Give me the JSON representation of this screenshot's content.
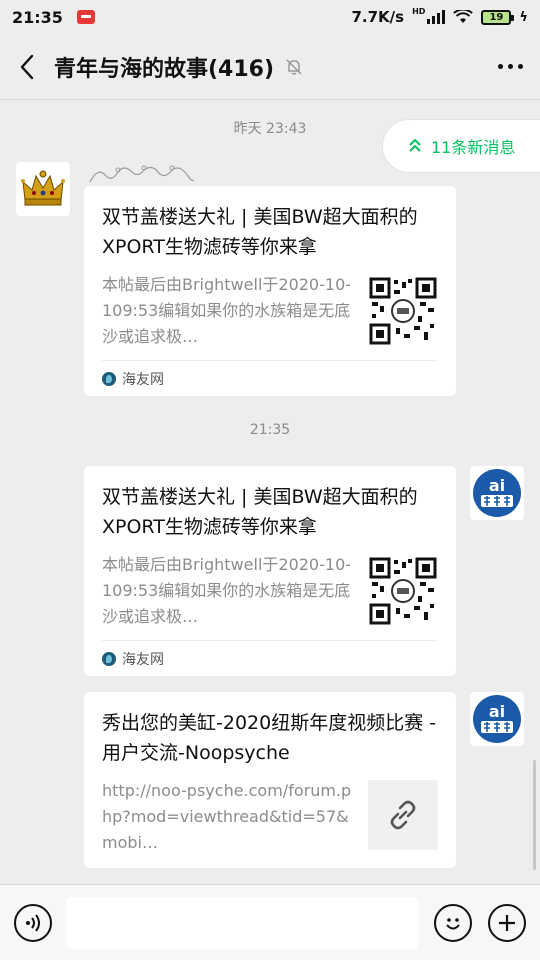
{
  "status_bar": {
    "time": "21:35",
    "net_speed": "7.7K/s",
    "hd_label": "HD",
    "battery": "19"
  },
  "header": {
    "title": "青年与海的故事(416)"
  },
  "new_messages": {
    "label": "11条新消息"
  },
  "timestamps": {
    "yesterday": "昨天 23:43",
    "today": "21:35"
  },
  "messages": [
    {
      "title": "双节盖楼送大礼 | 美国BW超大面积的XPORT生物滤砖等你来拿",
      "desc": "本帖最后由Brightwell于2020-10-109:53编辑如果你的水族箱是无底沙或追求极…",
      "source": "海友网"
    },
    {
      "title": "双节盖楼送大礼 | 美国BW超大面积的XPORT生物滤砖等你来拿",
      "desc": "本帖最后由Brightwell于2020-10-109:53编辑如果你的水族箱是无底沙或追求极…",
      "source": "海友网"
    },
    {
      "title": "秀出您的美缸-2020纽斯年度视频比赛 - 用户交流-Noopsyche",
      "desc": "http://noo-psyche.com/forum.php?mod=viewthread&tid=57&mobi…"
    }
  ],
  "colors": {
    "accent": "#07c160",
    "background": "#ededed",
    "card": "#ffffff",
    "muted_text": "#8c8c8c"
  },
  "icons": {
    "back": "chevron-left-icon",
    "mute": "bell-off-icon",
    "more": "more-horizontal-icon",
    "new_messages": "double-chevron-up-icon",
    "link": "link-icon",
    "voice": "voice-icon",
    "emoji": "emoji-icon",
    "plus": "plus-icon"
  }
}
